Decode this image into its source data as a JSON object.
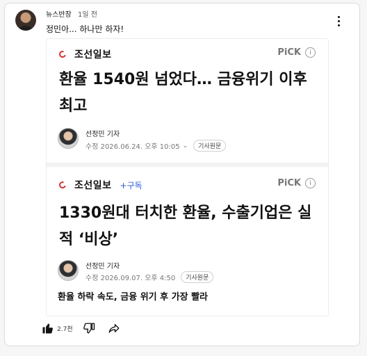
{
  "post": {
    "author": "뉴스반장",
    "time_ago": "1일 전",
    "text": "정민아... 하나만 하자!"
  },
  "article1": {
    "press": "조선일보",
    "pick": "PiCK",
    "headline": "환율 1540원 넘었다… 금융위기 이후 최고",
    "reporter": "선정민 기자",
    "edited": "수정 2026.06.24. 오후 10:05",
    "original": "기사원문"
  },
  "article2": {
    "press": "조선일보",
    "subscribe": "+구독",
    "pick": "PiCK",
    "headline": "1330원대 터치한 환율, 수출기업은 실적 ‘비상’",
    "reporter": "선정민 기자",
    "edited": "수정 2026.09.07. 오후 4:50",
    "original": "기사원문",
    "caption": "환율 하락 속도, 금융 위기 후 가장 빨라"
  },
  "actions": {
    "likes": "2.7천",
    "icons": [
      "thumbs-up-icon",
      "thumbs-down-icon",
      "share-icon"
    ]
  },
  "colors": {
    "logo_red": "#d72b2b",
    "subscribe_blue": "#2c59d8"
  }
}
